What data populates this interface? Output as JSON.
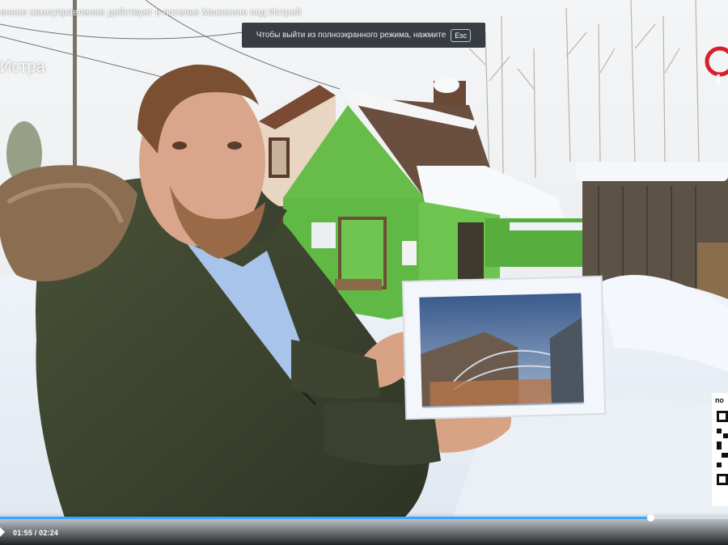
{
  "video": {
    "title": "енное самоуправление действует в поселке Манихино под Истрой",
    "channel": "Истра"
  },
  "fullscreen_notice": {
    "text": "Чтобы выйти из полноэкранного режима, нажмите",
    "key": "Esc"
  },
  "player": {
    "current_time": "01:55",
    "duration": "02:24",
    "time_display": "01:55 / 02:24",
    "progress_fraction": 0.893,
    "progress_color": "#36a8ff"
  },
  "overlay": {
    "qr_label": "по"
  },
  "icons": {
    "play": "play-icon",
    "logo": "channel-logo-icon",
    "qr": "qr-code-icon"
  }
}
